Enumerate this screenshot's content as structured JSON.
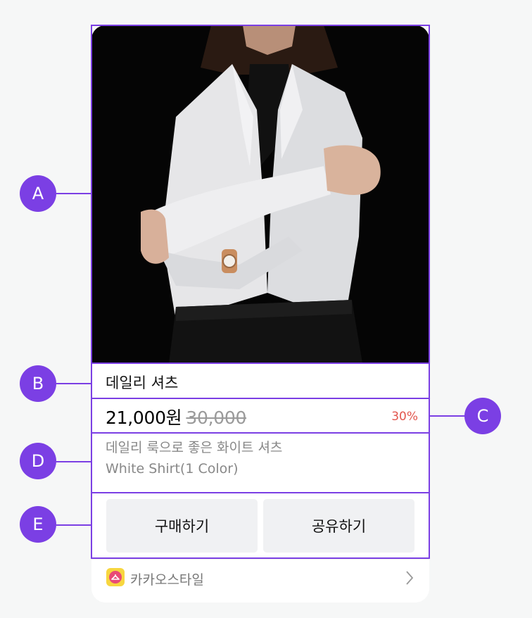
{
  "product": {
    "title": "데일리 셔츠",
    "price": "21,000원",
    "original_price": "30,000",
    "discount": "30%",
    "description_line1": "데일리 룩으로 좋은 화이트 셔츠",
    "description_line2": "White Shirt(1 Color)"
  },
  "buttons": {
    "buy_label": "구매하기",
    "share_label": "공유하기"
  },
  "footer": {
    "channel_name": "카카오스타일",
    "chevron_icon": "chevron-right-icon",
    "logo_icon": "hanger-icon"
  },
  "annotations": {
    "labels": [
      "A",
      "B",
      "C",
      "D",
      "E"
    ],
    "color": "#7b3fe4"
  },
  "colors": {
    "discount": "#e2564e",
    "button_bg": "#f0f1f3",
    "logo_bg": "#f7d63f",
    "logo_dot": "#e94a76"
  }
}
